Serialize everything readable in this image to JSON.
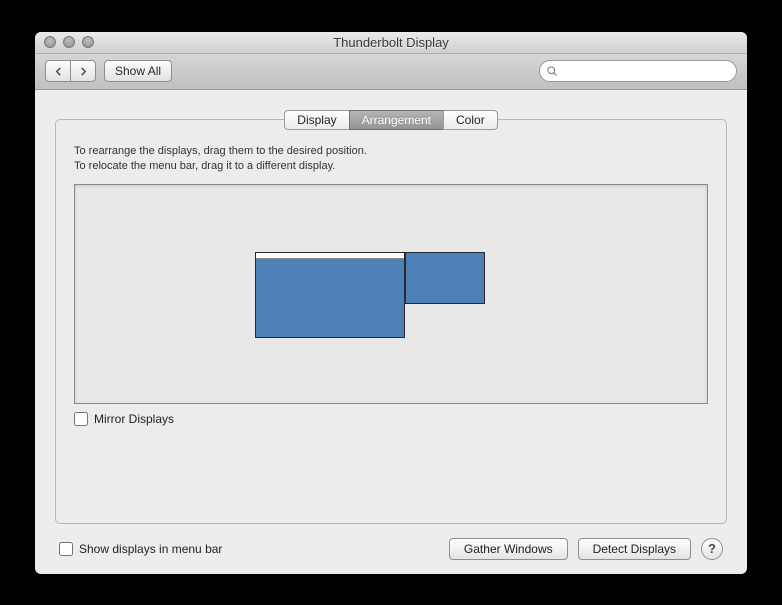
{
  "window": {
    "title": "Thunderbolt Display"
  },
  "toolbar": {
    "show_all_label": "Show All",
    "search_placeholder": ""
  },
  "tabs": [
    {
      "label": "Display",
      "selected": false
    },
    {
      "label": "Arrangement",
      "selected": true
    },
    {
      "label": "Color",
      "selected": false
    }
  ],
  "panel": {
    "instructions_line1": "To rearrange the displays, drag them to the desired position.",
    "instructions_line2": "To relocate the menu bar, drag it to a different display.",
    "mirror_label": "Mirror Displays",
    "mirror_checked": false
  },
  "footer": {
    "show_in_menu_bar_label": "Show displays in menu bar",
    "show_in_menu_bar_checked": false,
    "gather_windows_label": "Gather Windows",
    "detect_displays_label": "Detect Displays",
    "help_label": "?"
  },
  "colors": {
    "display_fill": "#4d81b6"
  }
}
